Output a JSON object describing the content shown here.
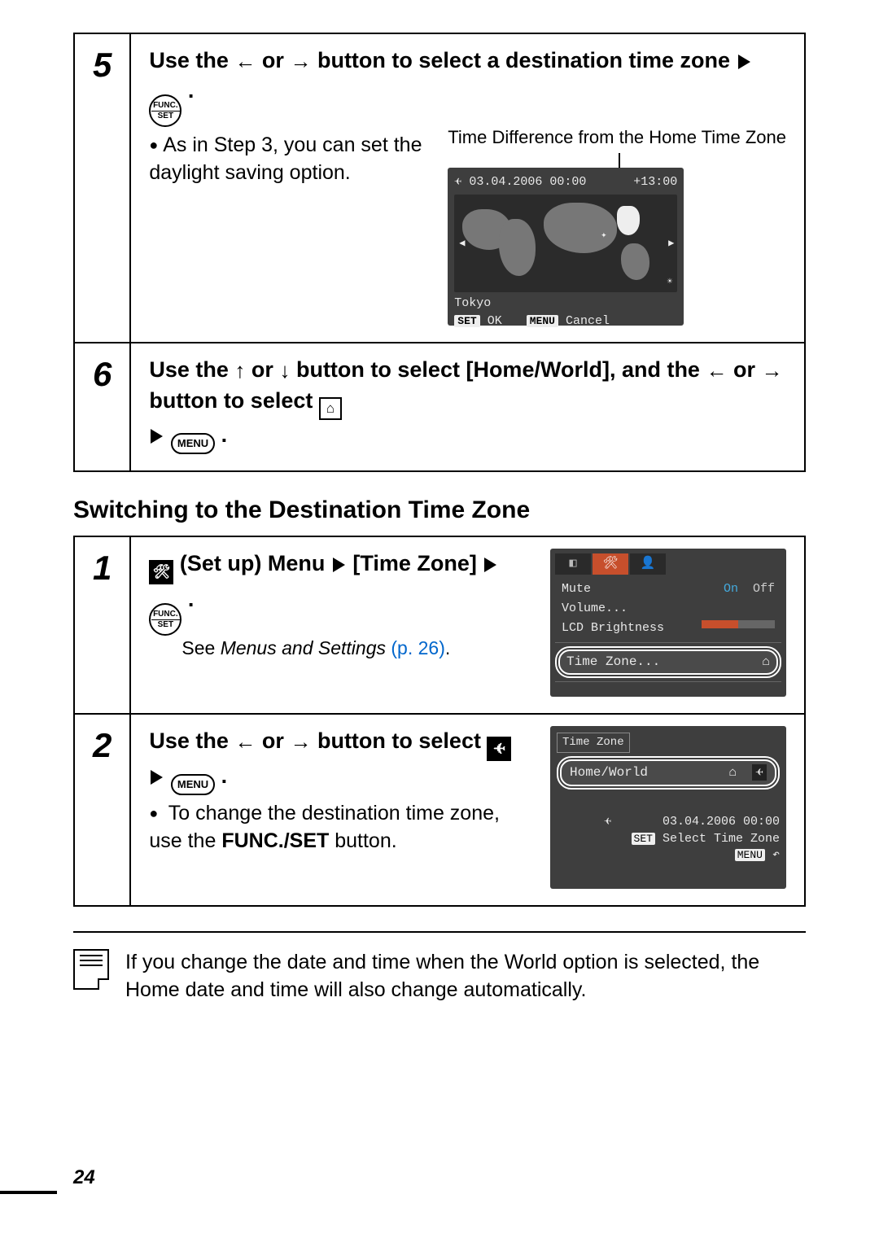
{
  "steps_top": [
    {
      "num": "5",
      "instr_pre": "Use the ",
      "instr_mid": " or ",
      "instr_post": " button to select a destination time zone",
      "sub": "As in Step 3, you can set the daylight saving option.",
      "caption": "Time Difference from the Home Time Zone",
      "lcd": {
        "date": "03.04.2006 00:00",
        "diff": "+13:00",
        "city": "Tokyo",
        "set": "SET",
        "ok": "OK",
        "menu": "MENU",
        "cancel": "Cancel"
      }
    },
    {
      "num": "6",
      "instr_parts": {
        "a": "Use the ",
        "b": " or ",
        "c": " button to select [Home/World], and the ",
        "d": " or ",
        "e": " button to select "
      }
    }
  ],
  "heading": "Switching to the Destination Time Zone",
  "steps_bottom": [
    {
      "num": "1",
      "instr_parts": {
        "a": " (Set up) Menu",
        "b": "[Time Zone]"
      },
      "ref_pre": "See ",
      "ref_em": "Menus and Settings",
      "ref_link": " (p. 26)",
      "lcd": {
        "mute": "Mute",
        "on": "On",
        "off": "Off",
        "volume": "Volume...",
        "lcdb": "LCD Brightness",
        "tz": "Time Zone..."
      }
    },
    {
      "num": "2",
      "instr_parts": {
        "a": "Use the ",
        "b": " or ",
        "c": " button to select "
      },
      "sub_parts": {
        "a": "To change the destination time zone, use the ",
        "b": "FUNC./SET",
        "c": " button."
      },
      "lcd": {
        "title": "Time Zone",
        "hw": "Home/World",
        "date": "03.04.2006 00:00",
        "set": "SET",
        "sel": "Select Time Zone",
        "menu": "MENU"
      }
    }
  ],
  "note": "If you change the date and time when the World option is selected, the Home date and time will also change automatically.",
  "page": "24",
  "icons": {
    "menu_label": "MENU"
  }
}
